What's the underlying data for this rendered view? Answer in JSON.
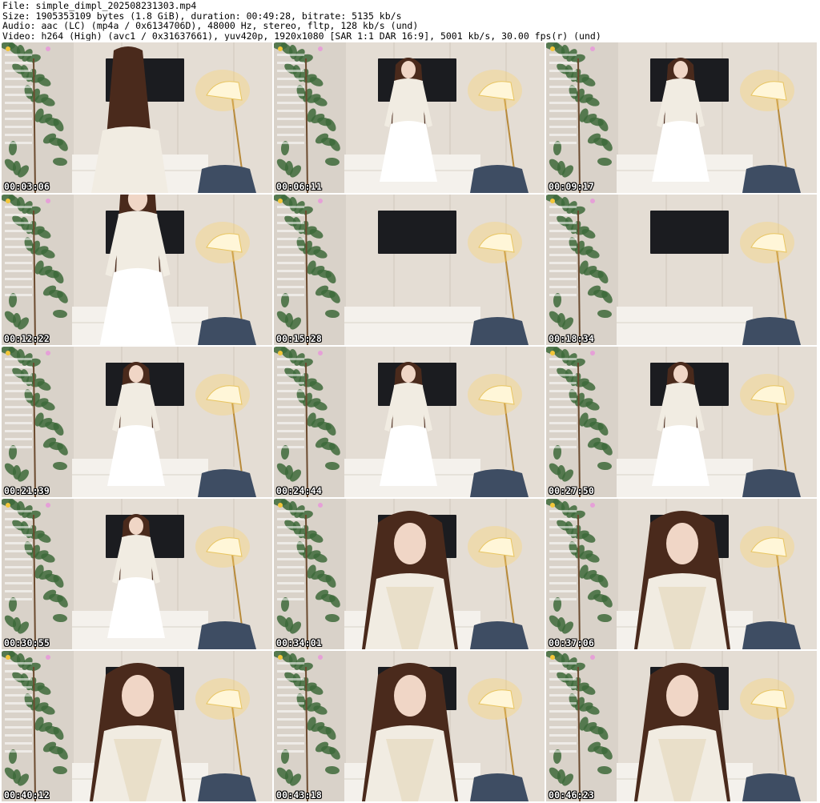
{
  "header": {
    "file_line": "File: simple_dimpl_202508231303.mp4",
    "size_line": "Size: 1905353109 bytes (1.8 GiB), duration: 00:49:28, bitrate: 5135 kb/s",
    "audio_line": "Audio: aac (LC) (mp4a / 0x6134706D), 48000 Hz, stereo, fltp, 128 kb/s (und)",
    "video_line": "Video: h264 (High) (avc1 / 0x31637661), yuv420p, 1920x1080 [SAR 1:1 DAR 16:9], 5001 kb/s, 30.00 fps(r) (und)"
  },
  "thumbnails": [
    {
      "timestamp": "00:03:06",
      "pose": "back-hair"
    },
    {
      "timestamp": "00:06:11",
      "pose": "standing-far"
    },
    {
      "timestamp": "00:09:17",
      "pose": "standing-far"
    },
    {
      "timestamp": "00:12:22",
      "pose": "standing-near"
    },
    {
      "timestamp": "00:15:28",
      "pose": "empty"
    },
    {
      "timestamp": "00:18:34",
      "pose": "empty"
    },
    {
      "timestamp": "00:21:39",
      "pose": "standing-far"
    },
    {
      "timestamp": "00:24:44",
      "pose": "leaning"
    },
    {
      "timestamp": "00:27:50",
      "pose": "standing-far"
    },
    {
      "timestamp": "00:30:55",
      "pose": "standing-far"
    },
    {
      "timestamp": "00:34:01",
      "pose": "seated-close"
    },
    {
      "timestamp": "00:37:06",
      "pose": "seated-close"
    },
    {
      "timestamp": "00:40:12",
      "pose": "seated-close"
    },
    {
      "timestamp": "00:43:18",
      "pose": "seated-close"
    },
    {
      "timestamp": "00:46:23",
      "pose": "seated-close"
    }
  ],
  "colors": {
    "wall": "#d9d2c9",
    "wall_light": "#ece6dd",
    "dress": "#f1ece2",
    "hair": "#4a2a1c",
    "lamp_glow": "#ffd36a",
    "plant": "#3d6a3a",
    "chair": "#3e4d63",
    "tv": "#1b1c20",
    "timestamp_text": "#ffffff"
  }
}
